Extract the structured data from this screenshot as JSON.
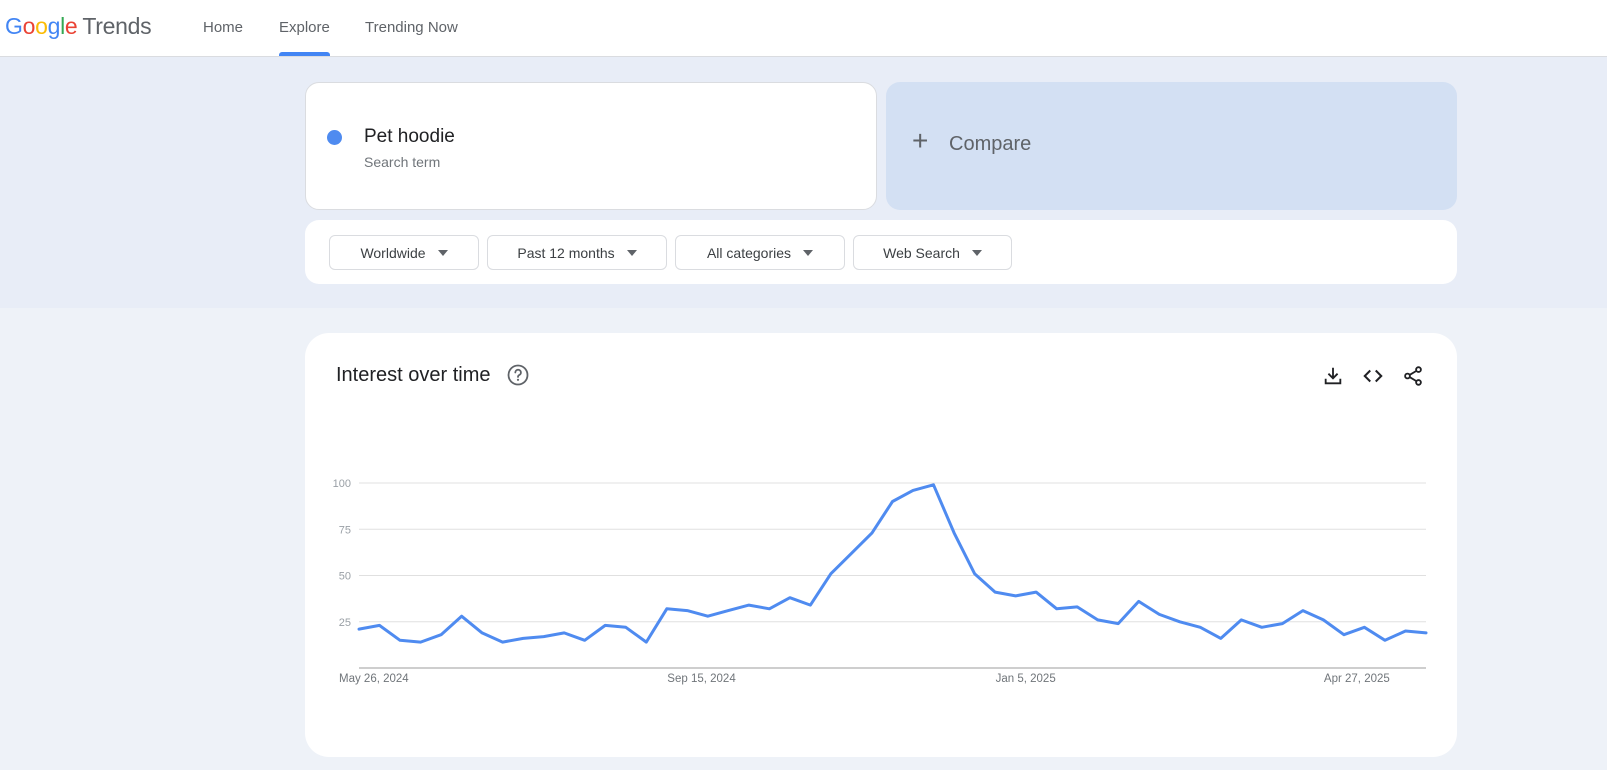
{
  "header": {
    "logo_letters": [
      "G",
      "o",
      "o",
      "g",
      "l",
      "e"
    ],
    "logo_product": "Trends",
    "nav": [
      {
        "label": "Home",
        "active": false
      },
      {
        "label": "Explore",
        "active": true
      },
      {
        "label": "Trending Now",
        "active": false
      }
    ]
  },
  "search": {
    "term": "Pet hoodie",
    "term_type": "Search term",
    "term_color": "#4f8bf0",
    "compare_label": "Compare"
  },
  "filters": [
    {
      "label": "Worldwide"
    },
    {
      "label": "Past 12 months"
    },
    {
      "label": "All categories"
    },
    {
      "label": "Web Search"
    }
  ],
  "chart_panel": {
    "title": "Interest over time",
    "icons": [
      "help-icon",
      "download-icon",
      "embed-code-icon",
      "share-icon"
    ]
  },
  "chart_data": {
    "type": "line",
    "title": "Interest over time",
    "xlabel": "",
    "ylabel": "",
    "ylim": [
      0,
      100
    ],
    "yticks": [
      25,
      50,
      75,
      100
    ],
    "grid": true,
    "x_tick_labels": [
      "May 26, 2024",
      "Sep 15, 2024",
      "Jan 5, 2025",
      "Apr 27, 2025"
    ],
    "x_tick_indices": [
      0,
      16,
      32,
      48
    ],
    "line_color": "#4f8bf0",
    "series": [
      {
        "values": [
          21,
          23,
          15,
          14,
          18,
          28,
          19,
          14,
          16,
          17,
          19,
          15,
          23,
          22,
          14,
          32,
          31,
          28,
          31,
          34,
          32,
          38,
          34,
          51,
          62,
          73,
          90,
          96,
          99,
          73,
          51,
          41,
          39,
          41,
          32,
          33,
          26,
          24,
          36,
          29,
          25,
          22,
          16,
          26,
          22,
          24,
          31,
          26,
          18,
          22,
          15,
          20,
          19
        ]
      }
    ]
  }
}
